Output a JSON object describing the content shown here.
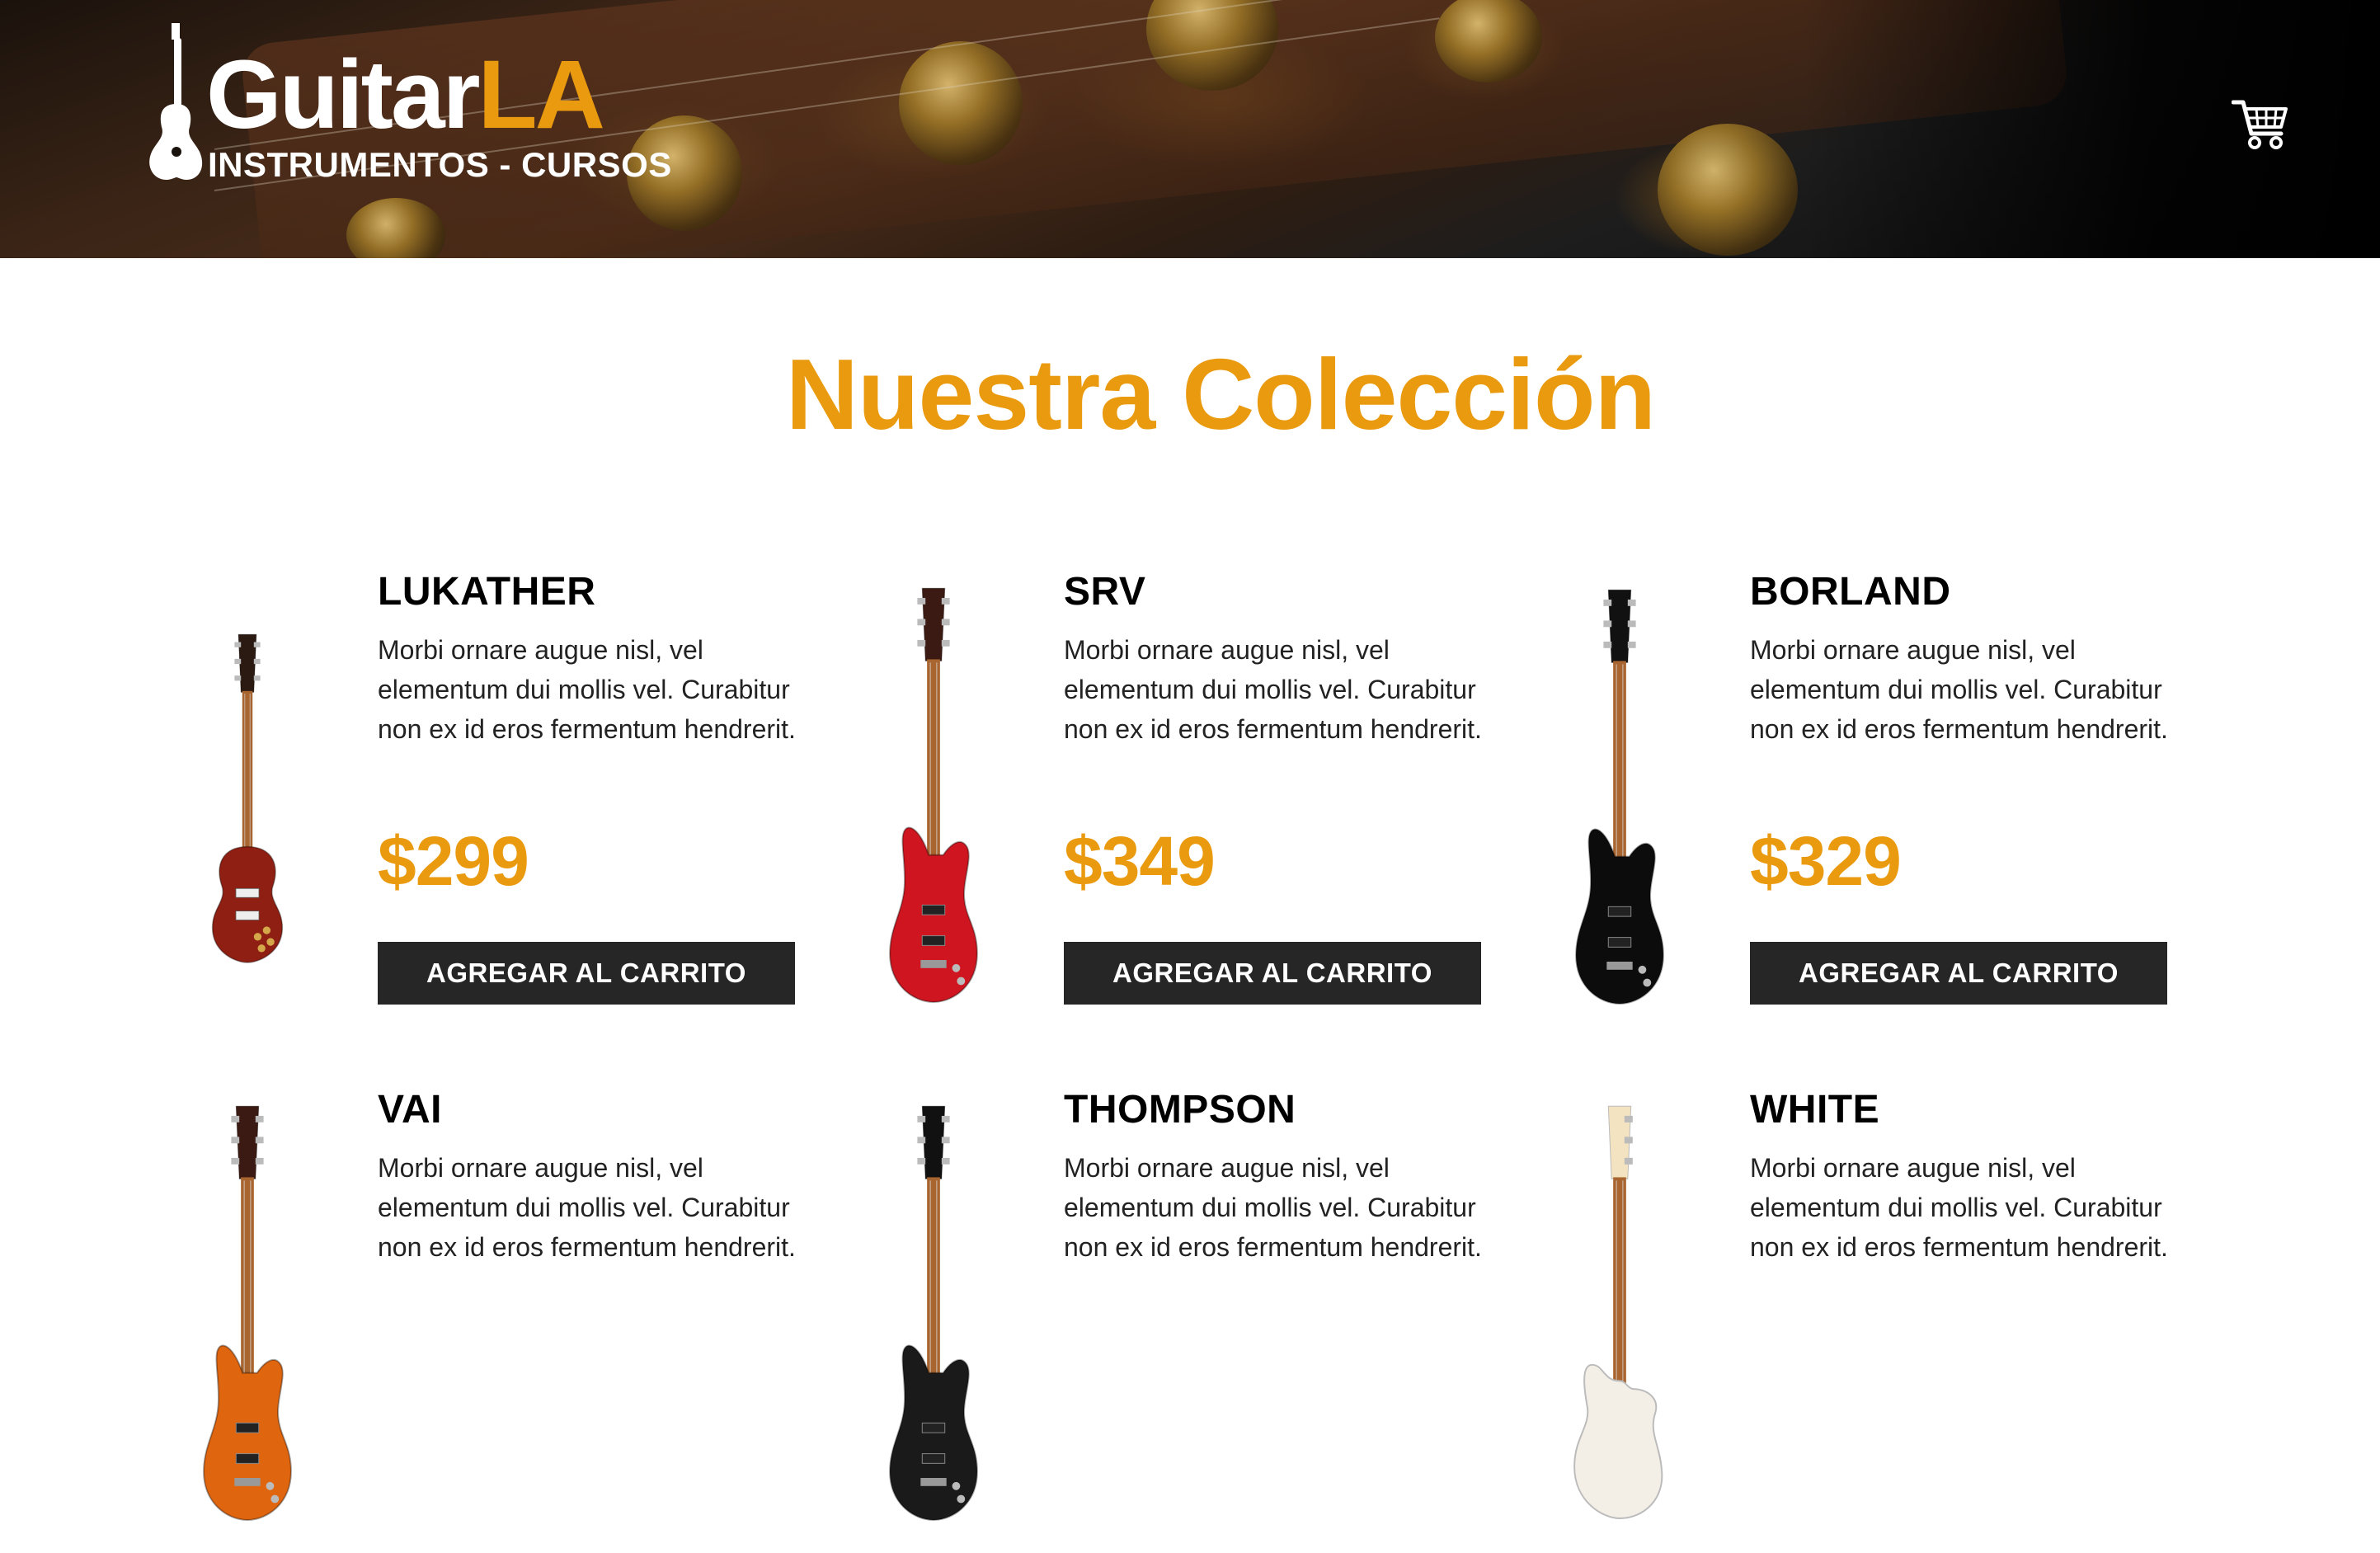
{
  "header": {
    "logo": {
      "word_part1": "Guitar",
      "word_part2": "LA",
      "tagline": "INSTRUMENTOS - CURSOS"
    },
    "cart_icon": "cart-icon"
  },
  "main": {
    "title": "Nuestra Colección",
    "products": [
      {
        "name": "LUKATHER",
        "description": "Morbi ornare augue nisl, vel elementum dui mollis vel. Curabitur non ex id eros fermentum hendrerit.",
        "price": "$299",
        "button_label": "AGREGAR AL CARRITO",
        "body_color": "#8e1f12",
        "style": "lespaul"
      },
      {
        "name": "SRV",
        "description": "Morbi ornare augue nisl, vel elementum dui mollis vel. Curabitur non ex id eros fermentum hendrerit.",
        "price": "$349",
        "button_label": "AGREGAR AL CARRITO",
        "body_color": "#cf1620",
        "style": "superstrat"
      },
      {
        "name": "BORLAND",
        "description": "Morbi ornare augue nisl, vel elementum dui mollis vel. Curabitur non ex id eros fermentum hendrerit.",
        "price": "$329",
        "button_label": "AGREGAR AL CARRITO",
        "body_color": "#0c0c0c",
        "style": "superstrat"
      },
      {
        "name": "VAI",
        "description": "Morbi ornare augue nisl, vel elementum dui mollis vel. Curabitur non ex id eros fermentum hendrerit.",
        "price": "",
        "button_label": "",
        "body_color": "#e0650f",
        "style": "superstrat"
      },
      {
        "name": "THOMPSON",
        "description": "Morbi ornare augue nisl, vel elementum dui mollis vel. Curabitur non ex id eros fermentum hendrerit.",
        "price": "",
        "button_label": "",
        "body_color": "#1a1a1a",
        "style": "superstrat"
      },
      {
        "name": "WHITE",
        "description": "Morbi ornare augue nisl, vel elementum dui mollis vel. Curabitur non ex id eros fermentum hendrerit.",
        "price": "",
        "button_label": "",
        "body_color": "#f3efe6",
        "style": "strat"
      }
    ]
  },
  "colors": {
    "accent": "#e99a0f",
    "button_bg": "#262626",
    "header_bg": "#1a120c"
  }
}
